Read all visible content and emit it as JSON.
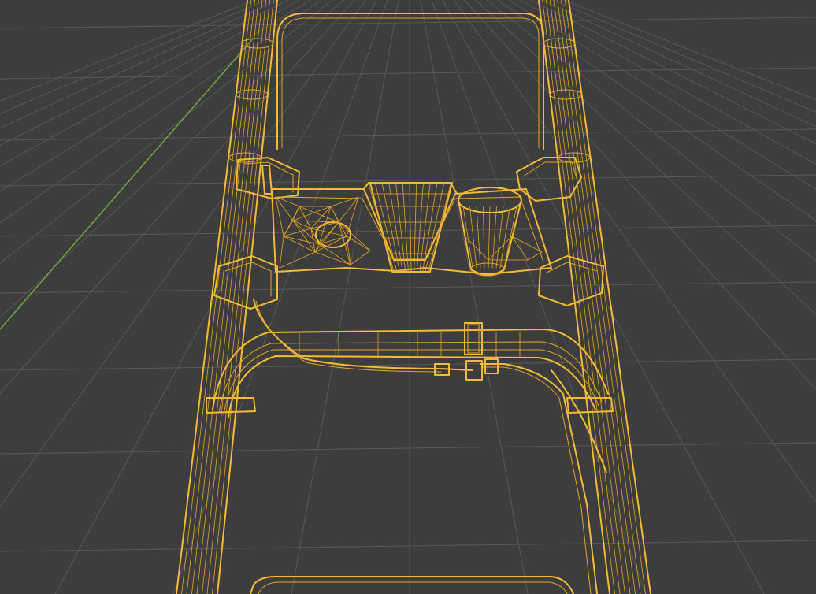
{
  "viewport": {
    "shading_mode": "wireframe",
    "view": "perspective",
    "background_color": "#3d3d3d",
    "grid_color": "#585858",
    "grid_dark_color": "#4c4c4c",
    "y_axis_color": "#6fa83a",
    "wire_color": "#e3a526",
    "wire_edge_color": "#f3bb35"
  },
  "object": {
    "name": "walker",
    "selected": true,
    "parts": [
      "left-frame-tube",
      "right-frame-tube",
      "top-handle-bar",
      "seat-storage-basket",
      "cup-holder",
      "cross-bar",
      "brake-cable",
      "lower-basket-rail"
    ]
  }
}
